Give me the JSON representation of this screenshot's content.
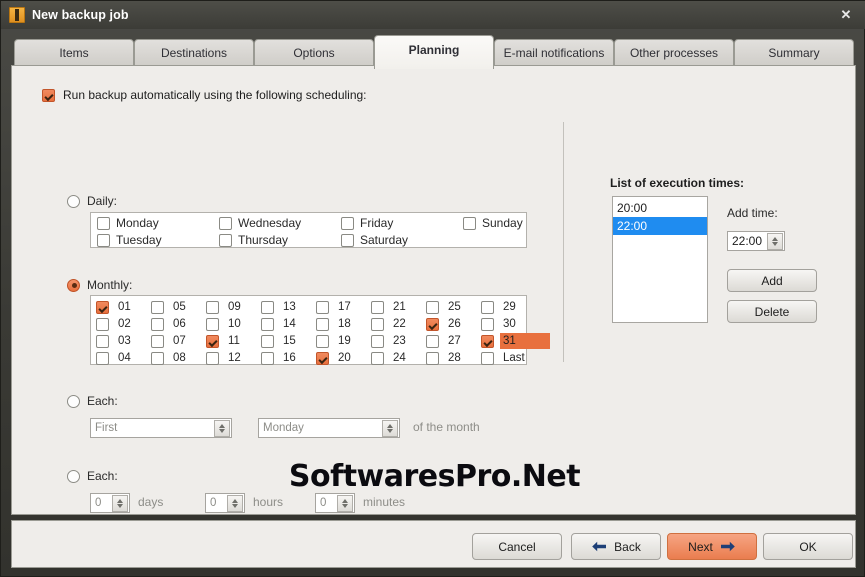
{
  "window": {
    "title": "New backup job",
    "icon": "backup-app-icon",
    "close_label": "✕"
  },
  "tabs": [
    {
      "label": "Items",
      "active": false
    },
    {
      "label": "Destinations",
      "active": false
    },
    {
      "label": "Options",
      "active": false
    },
    {
      "label": "Planning",
      "active": true
    },
    {
      "label": "E-mail notifications",
      "active": false
    },
    {
      "label": "Other processes",
      "active": false
    },
    {
      "label": "Summary",
      "active": false
    }
  ],
  "main": {
    "enable_checkbox": {
      "label": "Run backup automatically using the following scheduling:",
      "checked": true
    },
    "daily": {
      "radio_label": "Daily:",
      "selected": false,
      "days": [
        {
          "label": "Monday",
          "checked": false
        },
        {
          "label": "Tuesday",
          "checked": false
        },
        {
          "label": "Wednesday",
          "checked": false
        },
        {
          "label": "Thursday",
          "checked": false
        },
        {
          "label": "Friday",
          "checked": false
        },
        {
          "label": "Saturday",
          "checked": false
        },
        {
          "label": "Sunday",
          "checked": false
        }
      ]
    },
    "monthly": {
      "radio_label": "Monthly:",
      "selected": true,
      "days": [
        {
          "label": "01",
          "checked": true,
          "highlighted": false
        },
        {
          "label": "02",
          "checked": false,
          "highlighted": false
        },
        {
          "label": "03",
          "checked": false,
          "highlighted": false
        },
        {
          "label": "04",
          "checked": false,
          "highlighted": false
        },
        {
          "label": "05",
          "checked": false,
          "highlighted": false
        },
        {
          "label": "06",
          "checked": false,
          "highlighted": false
        },
        {
          "label": "07",
          "checked": false,
          "highlighted": false
        },
        {
          "label": "08",
          "checked": false,
          "highlighted": false
        },
        {
          "label": "09",
          "checked": false,
          "highlighted": false
        },
        {
          "label": "10",
          "checked": false,
          "highlighted": false
        },
        {
          "label": "11",
          "checked": true,
          "highlighted": false
        },
        {
          "label": "12",
          "checked": false,
          "highlighted": false
        },
        {
          "label": "13",
          "checked": false,
          "highlighted": false
        },
        {
          "label": "14",
          "checked": false,
          "highlighted": false
        },
        {
          "label": "15",
          "checked": false,
          "highlighted": false
        },
        {
          "label": "16",
          "checked": false,
          "highlighted": false
        },
        {
          "label": "17",
          "checked": false,
          "highlighted": false
        },
        {
          "label": "18",
          "checked": false,
          "highlighted": false
        },
        {
          "label": "19",
          "checked": false,
          "highlighted": false
        },
        {
          "label": "20",
          "checked": true,
          "highlighted": false
        },
        {
          "label": "21",
          "checked": false,
          "highlighted": false
        },
        {
          "label": "22",
          "checked": false,
          "highlighted": false
        },
        {
          "label": "23",
          "checked": false,
          "highlighted": false
        },
        {
          "label": "24",
          "checked": false,
          "highlighted": false
        },
        {
          "label": "25",
          "checked": false,
          "highlighted": false
        },
        {
          "label": "26",
          "checked": true,
          "highlighted": false
        },
        {
          "label": "27",
          "checked": false,
          "highlighted": false
        },
        {
          "label": "28",
          "checked": false,
          "highlighted": false
        },
        {
          "label": "29",
          "checked": false,
          "highlighted": false
        },
        {
          "label": "30",
          "checked": false,
          "highlighted": false
        },
        {
          "label": "31",
          "checked": true,
          "highlighted": true
        },
        {
          "label": "Last",
          "checked": false,
          "highlighted": false
        }
      ]
    },
    "each_ordinal": {
      "radio_label": "Each:",
      "selected": false,
      "ordinal_value": "First",
      "weekday_value": "Monday",
      "suffix_label": "of the month"
    },
    "each_interval": {
      "radio_label": "Each:",
      "selected": false,
      "days_value": "0",
      "days_label": "days",
      "hours_value": "0",
      "hours_label": "hours",
      "minutes_value": "0",
      "minutes_label": "minutes"
    }
  },
  "execution": {
    "title": "List of execution times:",
    "times": [
      {
        "label": "20:00",
        "selected": false
      },
      {
        "label": "22:00",
        "selected": true
      }
    ],
    "add_time_label": "Add time:",
    "add_time_value": "22:00",
    "add_button": "Add",
    "delete_button": "Delete"
  },
  "watermark": "SoftwaresPro.Net",
  "footer": {
    "cancel": "Cancel",
    "back": "Back",
    "next": "Next",
    "ok": "OK"
  },
  "colors": {
    "accent_orange": "#e8703e",
    "selection_blue": "#1f8cf0",
    "panel_bg": "#efedea",
    "titlebar": "#3c3c37"
  }
}
